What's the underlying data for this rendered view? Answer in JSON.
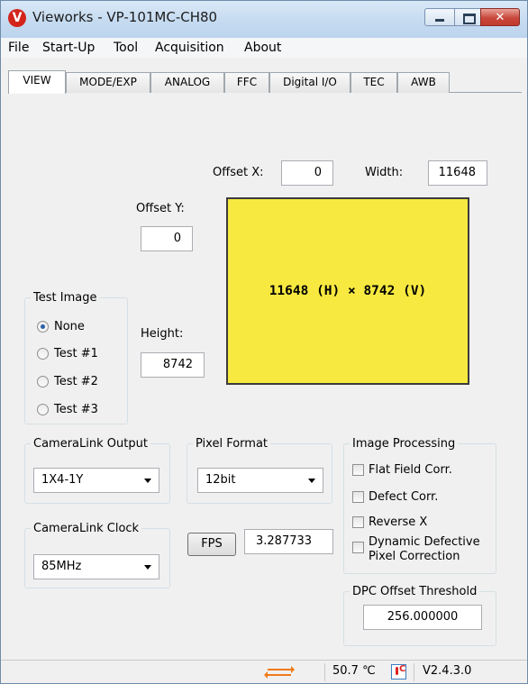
{
  "window": {
    "title": "Vieworks - VP-101MC-CH80"
  },
  "menu": {
    "items": [
      "File",
      "Start-Up",
      "Tool",
      "Acquisition",
      "About"
    ]
  },
  "tabs": [
    "VIEW",
    "MODE/EXP",
    "ANALOG",
    "FFC",
    "Digital I/O",
    "TEC",
    "AWB"
  ],
  "active_tab": "VIEW",
  "view": {
    "offset_x_label": "Offset X:",
    "offset_x_value": "0",
    "width_label": "Width:",
    "width_value": "11648",
    "offset_y_label": "Offset Y:",
    "offset_y_value": "0",
    "height_label": "Height:",
    "height_value": "8742",
    "preview_text": "11648 (H) × 8742 (V)",
    "preview_color": "#f7e940"
  },
  "test_image": {
    "legend": "Test Image",
    "options": [
      "None",
      "Test #1",
      "Test #2",
      "Test #3"
    ],
    "selected": "None"
  },
  "cameralink_output": {
    "legend": "CameraLink Output",
    "value": "1X4-1Y"
  },
  "pixel_format": {
    "legend": "Pixel Format",
    "value": "12bit"
  },
  "cameralink_clock": {
    "legend": "CameraLink Clock",
    "value": "85MHz"
  },
  "fps": {
    "button": "FPS",
    "value": "3.287733"
  },
  "image_processing": {
    "legend": "Image Processing",
    "options": [
      "Flat Field Corr.",
      "Defect Corr.",
      "Reverse X",
      "Dynamic Defective",
      "Pixel Correction"
    ]
  },
  "dpc": {
    "legend": "DPC Offset Threshold",
    "value": "256.000000"
  },
  "status": {
    "temperature": "50.7 ℃",
    "version": "V2.4.3.0",
    "arrow_color": "#f07a1a"
  }
}
